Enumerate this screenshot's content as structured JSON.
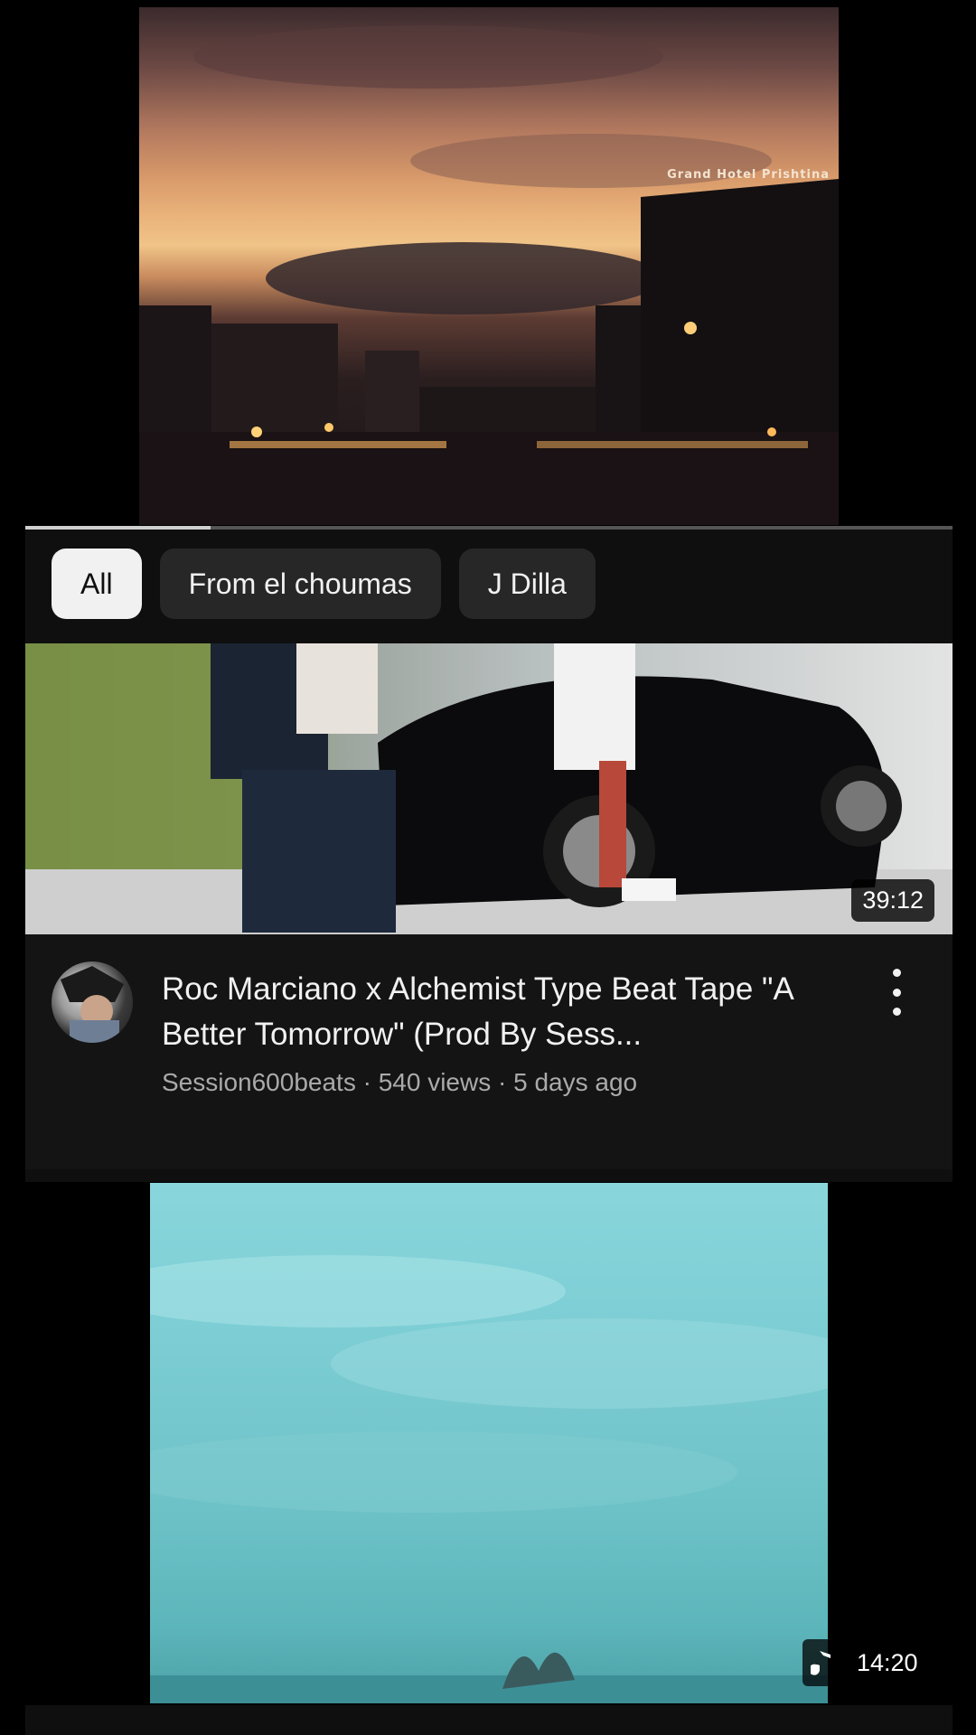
{
  "player": {
    "hotel_sign": "Grand Hotel Prishtina",
    "progress": 0.2
  },
  "chips": [
    {
      "label": "All",
      "active": true
    },
    {
      "label": "From el choumas",
      "active": false
    },
    {
      "label": "J Dilla",
      "active": false
    }
  ],
  "videos": [
    {
      "duration": "39:12",
      "title": "Roc Marciano x Alchemist Type Beat Tape \"A Better Tomorrow\" (Prod By Sess...",
      "channel": "Session600beats",
      "views": "540 views",
      "age": "5 days ago",
      "subtitle": "Session600beats · 540 views · 5 days ago"
    },
    {
      "duration": "14:20",
      "icon": "music-note-icon"
    }
  ],
  "colors": {
    "background": "#000000",
    "panel": "#0f0f0f",
    "chip": "#272727",
    "chip_active": "#f1f1f1",
    "secondary_text": "#aaaaaa"
  }
}
